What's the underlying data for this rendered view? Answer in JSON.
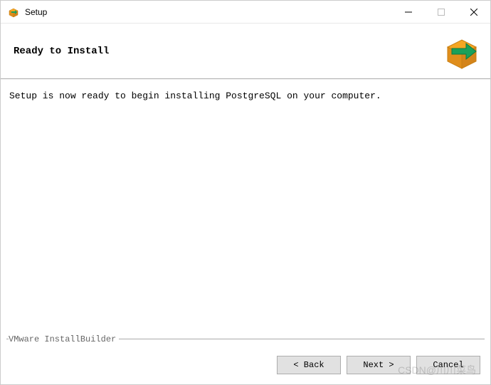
{
  "window": {
    "title": "Setup"
  },
  "header": {
    "title": "Ready to Install"
  },
  "main": {
    "message": "Setup is now ready to begin installing PostgreSQL on your computer."
  },
  "footer": {
    "branding": "VMware InstallBuilder",
    "buttons": {
      "back": "< Back",
      "next": "Next >",
      "cancel": "Cancel"
    }
  },
  "watermark": "CSDN@川川菜鸟",
  "icons": {
    "titlebar": "box-arrow-icon",
    "header_logo": "box-arrow-icon"
  }
}
